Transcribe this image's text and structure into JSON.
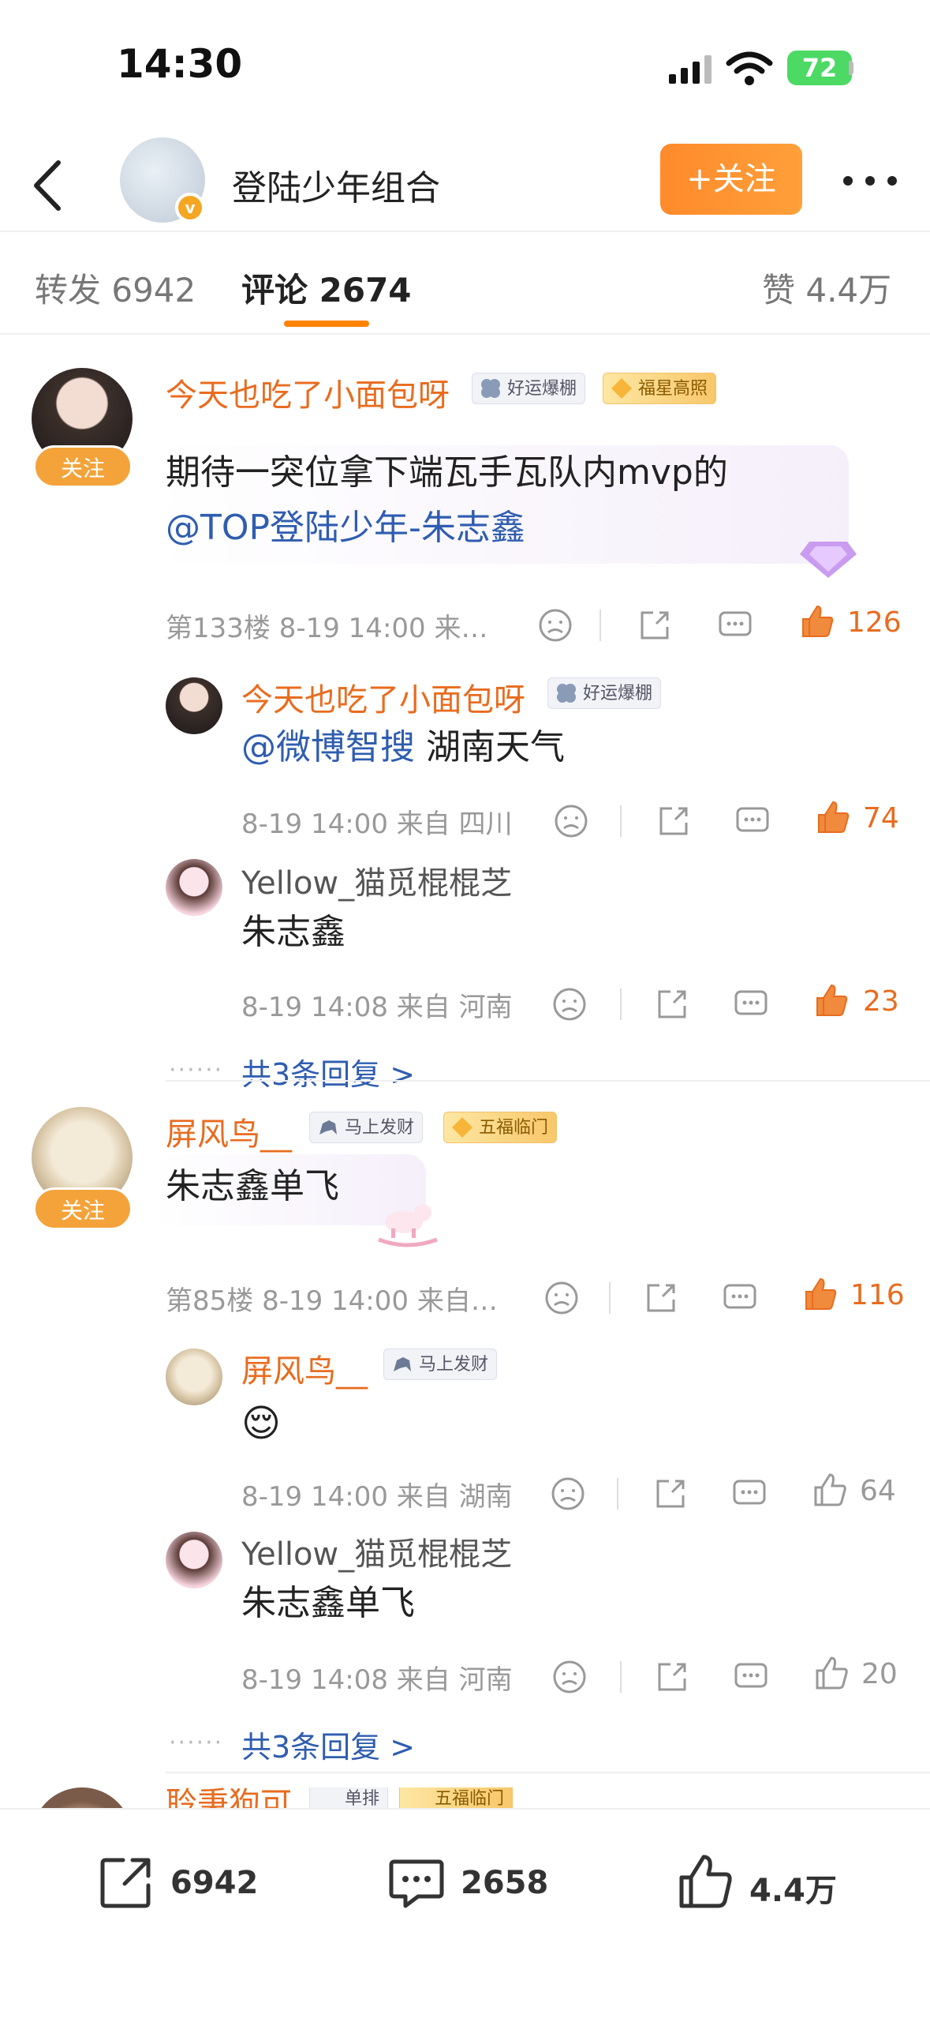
{
  "status_bar": {
    "time": "14:30",
    "battery": "72"
  },
  "header": {
    "title": "登陆少年组合",
    "follow_label": "+关注",
    "vbadge": "v"
  },
  "tabs": {
    "repost": "转发 6942",
    "comment": "评论 2674",
    "like": "赞 4.4万"
  },
  "comments": [
    {
      "user": "今天也吃了小面包呀",
      "follow": "关注",
      "badges": [
        "好运爆棚",
        "福星高照"
      ],
      "text": "期待一突位拿下端瓦手瓦队内mvp的",
      "mention": "@TOP登陆少年-朱志鑫",
      "meta": "第133楼 8-19 14:00 来…",
      "likes": "126",
      "replies": [
        {
          "user": "今天也吃了小面包呀",
          "badge": "好运爆棚",
          "mention": "@微博智搜",
          "text": " 湖南天气",
          "meta": "8-19 14:00 来自 四川",
          "likes": "74"
        },
        {
          "user": "Yellow_猫觅棍棍芝",
          "text": "朱志鑫",
          "meta": "8-19 14:08 来自 河南",
          "likes": "23"
        }
      ],
      "more": "共3条回复 >"
    },
    {
      "user": "屏风鸟__",
      "follow": "关注",
      "badges": [
        "马上发财",
        "五福临门"
      ],
      "text": "朱志鑫单飞",
      "meta": "第85楼 8-19 14:00 来自…",
      "likes": "116",
      "replies": [
        {
          "user": "屏风鸟__",
          "badge": "马上发财",
          "text": "😌",
          "meta": "8-19 14:00 来自 湖南",
          "likes": "64"
        },
        {
          "user": "Yellow_猫觅棍棍芝",
          "text": "朱志鑫单飞",
          "meta": "8-19 14:08 来自 河南",
          "likes": "20"
        }
      ],
      "more": "共3条回复 >"
    },
    {
      "user": "聆秉狗可",
      "badges": [
        "单排",
        "五福临门"
      ]
    }
  ],
  "dots": "······",
  "bottom": {
    "repost": "6942",
    "comment": "2658",
    "like": "4.4万"
  },
  "colors": {
    "accent": "#ff8200",
    "name": "#e86c1f",
    "link": "#2f5db0"
  }
}
